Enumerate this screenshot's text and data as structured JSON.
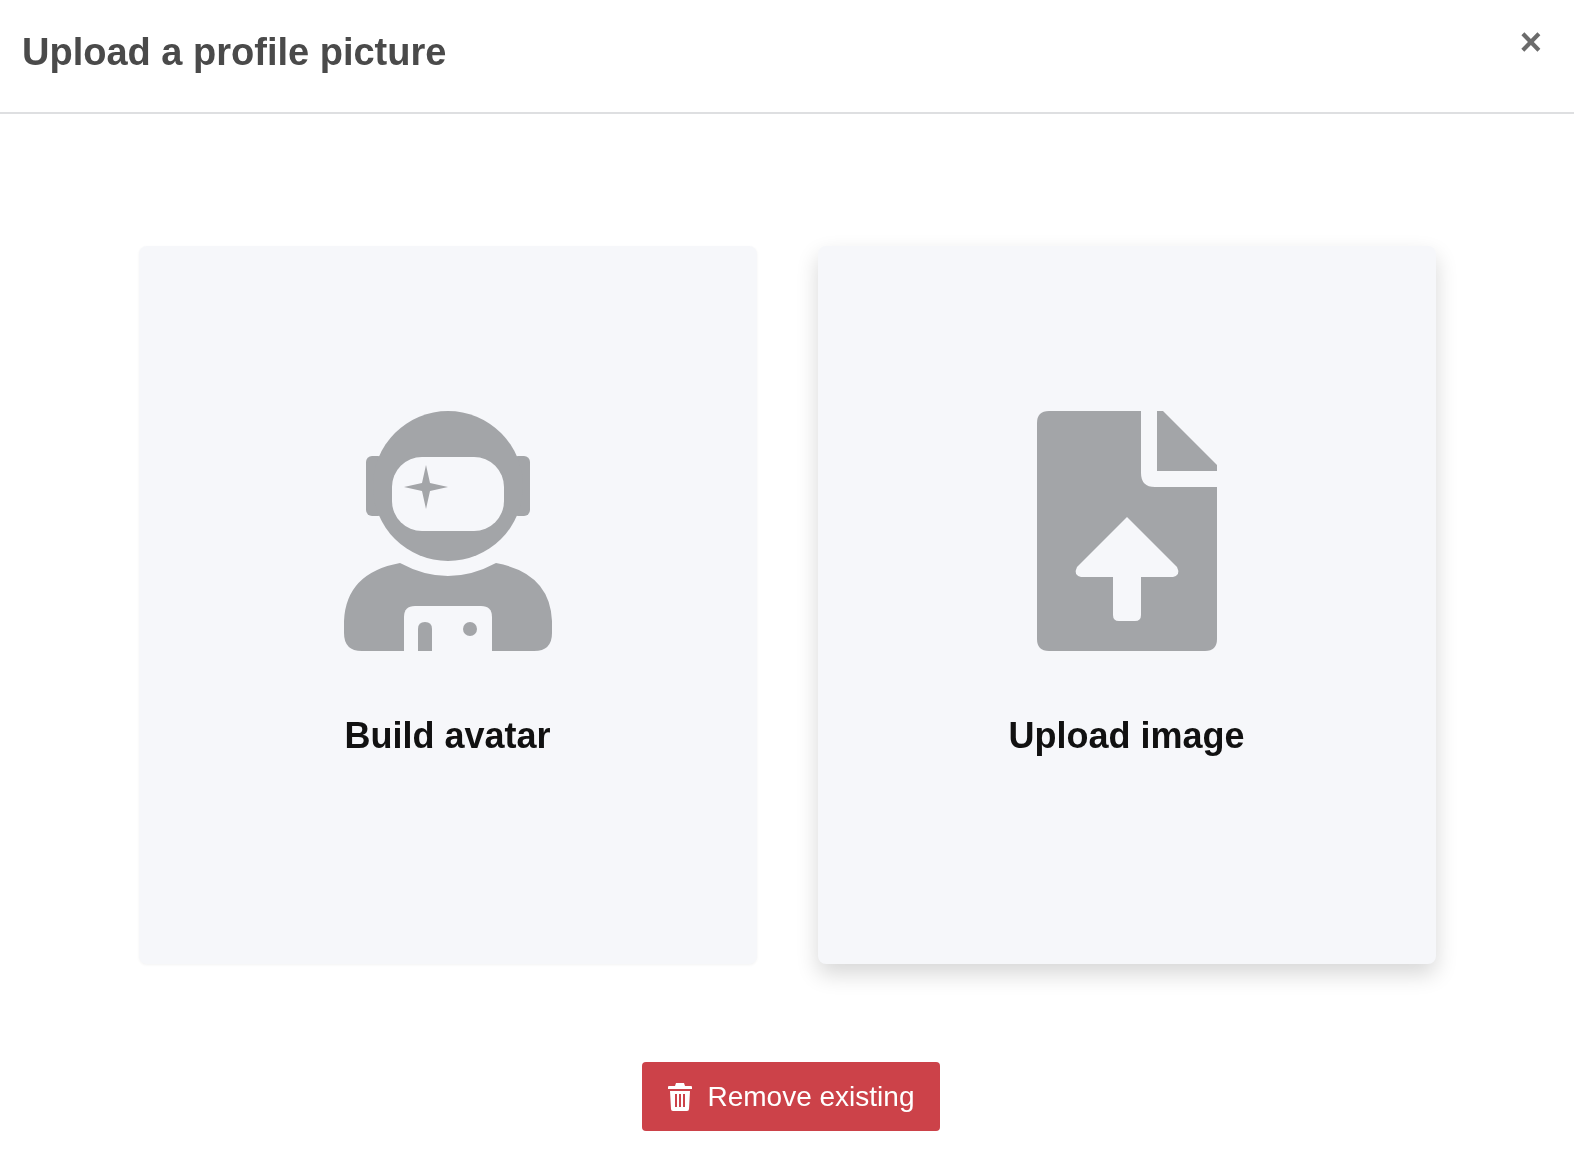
{
  "dialog": {
    "title": "Upload a profile picture",
    "close": "×"
  },
  "options": [
    {
      "kind": "avatar",
      "label": "Build avatar",
      "hovered": false
    },
    {
      "kind": "upload",
      "label": "Upload image",
      "hovered": true
    }
  ],
  "remove_button": {
    "label": "Remove existing"
  }
}
